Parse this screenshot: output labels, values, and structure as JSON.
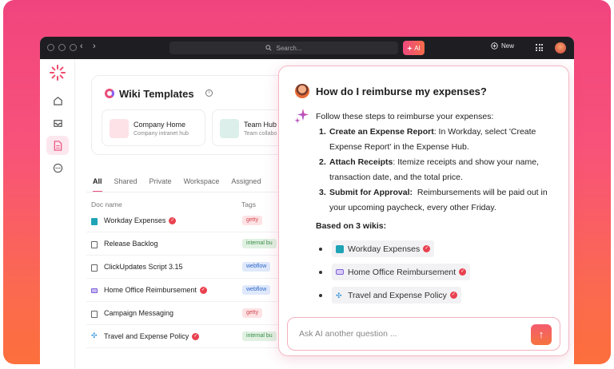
{
  "app": {
    "search_placeholder": "Search...",
    "ai_label": "AI",
    "new_label": "New"
  },
  "wiki": {
    "title": "Wiki Templates",
    "templates": [
      {
        "title": "Company Home",
        "subtitle": "Company intranet hub"
      },
      {
        "title": "Team Hub",
        "subtitle": "Team collabo"
      }
    ]
  },
  "tabs": [
    "All",
    "Shared",
    "Private",
    "Workspace",
    "Assigned"
  ],
  "table": {
    "headers": {
      "name": "Doc name",
      "tags": "Tags"
    },
    "rows": [
      {
        "name": "Workday Expenses",
        "verified": true,
        "tag": "getty",
        "tag_kind": "getty"
      },
      {
        "name": "Release Backlog",
        "verified": false,
        "tag": "internal bu",
        "tag_kind": "internal"
      },
      {
        "name": "ClickUpdates Script 3.15",
        "verified": false,
        "tag": "webflow",
        "tag_kind": "webflow"
      },
      {
        "name": "Home Office Reimbursement",
        "verified": true,
        "tag": "webflow",
        "tag_kind": "webflow"
      },
      {
        "name": "Campaign Messaging",
        "verified": false,
        "tag": "getty",
        "tag_kind": "getty"
      },
      {
        "name": "Travel and Expense Policy",
        "verified": true,
        "tag": "internal bu",
        "tag_kind": "internal"
      }
    ]
  },
  "ai": {
    "question": "How do I reimburse my expenses?",
    "intro": "Follow these steps to reimburse your expenses:",
    "steps": [
      {
        "num": "1.",
        "title": "Create an Expense Report",
        "text": ": In Workday, select 'Create Expense Report' in the Expense Hub."
      },
      {
        "num": "2.",
        "title": "Attach Receipts",
        "text": ": Itemize receipts and show your name, transaction date, and the total price."
      },
      {
        "num": "3.",
        "title": "Submit for Approval:",
        "text": "  Reimbursements will be paid out in your upcoming paycheck, every other Friday."
      }
    ],
    "based_on": "Based on 3 wikis:",
    "wikis": [
      {
        "name": "Workday Expenses",
        "icon": "teal",
        "color": "#1fa4b6"
      },
      {
        "name": "Home Office Reimbursement",
        "icon": "purple",
        "color": "#7e62d9"
      },
      {
        "name": "Travel and Expense Policy",
        "icon": "star",
        "color": "#2b8fd6"
      }
    ],
    "ask_placeholder": "Ask AI another question ...",
    "send_glyph": "↑"
  },
  "colors": {
    "brand_pink": "#e94e7a",
    "brand_orange": "#f5743f",
    "verified": "#e9414f"
  }
}
